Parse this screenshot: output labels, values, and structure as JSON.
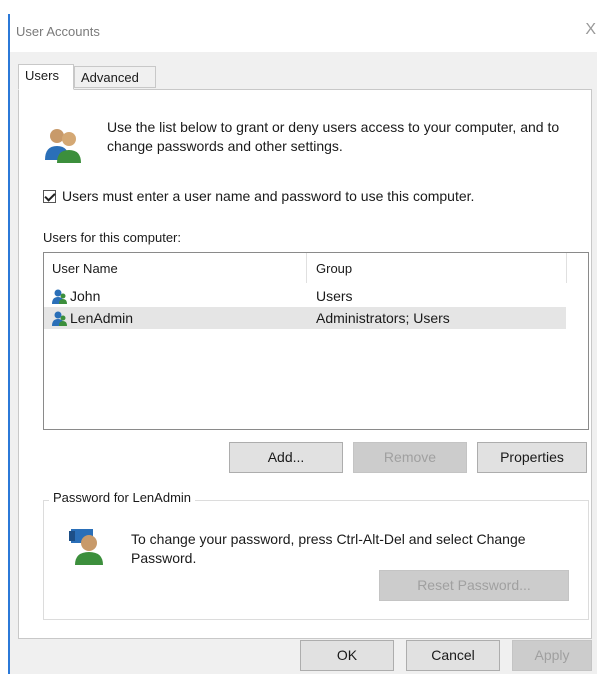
{
  "window": {
    "title": "User Accounts",
    "close_glyph": "X"
  },
  "tabs": [
    {
      "label": "Users",
      "active": true
    },
    {
      "label": "Advanced",
      "active": false
    }
  ],
  "intro": {
    "icon": "users-icon",
    "text": "Use the list below to grant or deny users access to your computer, and to change passwords and other settings."
  },
  "require_login": {
    "label": "Users must enter a user name and password to use this computer.",
    "checked": true
  },
  "users_list": {
    "label": "Users for this computer:",
    "columns": [
      "User Name",
      "Group"
    ],
    "rows": [
      {
        "name": "John",
        "group": "Users",
        "selected": false
      },
      {
        "name": "LenAdmin",
        "group": "Administrators; Users",
        "selected": true
      }
    ]
  },
  "list_buttons": {
    "add": "Add...",
    "remove": "Remove",
    "properties": "Properties"
  },
  "password_group": {
    "legend": "Password for LenAdmin",
    "icon": "user-key-icon",
    "text": "To change your password, press Ctrl-Alt-Del and select Change Password.",
    "reset_button": "Reset Password..."
  },
  "dialog_buttons": {
    "ok": "OK",
    "cancel": "Cancel",
    "apply": "Apply"
  },
  "colors": {
    "accent": "#2b79d8",
    "selection": "#e5e5e5",
    "user_icon_blue": "#2a6fb8",
    "user_icon_green": "#3c8f3c"
  }
}
